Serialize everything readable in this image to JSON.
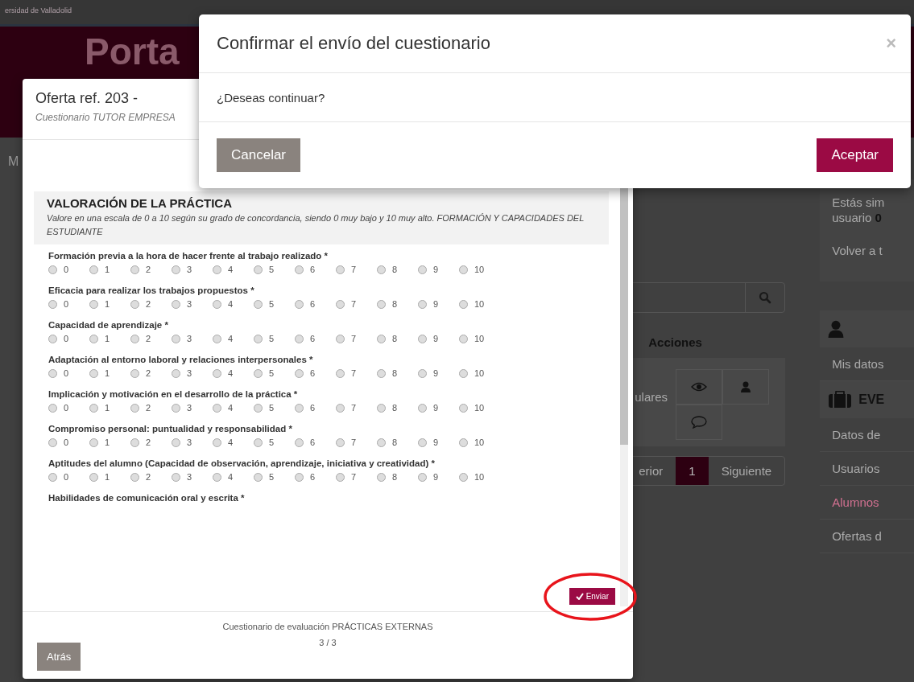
{
  "page": {
    "logo_text": "ersidad de Valladolid",
    "banner_title": "Porta",
    "nav_item": "M",
    "table": {
      "actions_header": "Acciones",
      "row_text": "ulares"
    },
    "pagination": [
      {
        "label": "erior",
        "selected": false
      },
      {
        "label": "1",
        "selected": true
      },
      {
        "label": "Siguiente",
        "selected": false
      }
    ],
    "sidebar": {
      "notice": "Estás sim",
      "notice_user": "usuario **0**",
      "back_link": "Volver a t",
      "profile_link": "Mis datos",
      "section_title": "EVE",
      "items": [
        {
          "label": "Datos de",
          "selected": false
        },
        {
          "label": "Usuarios",
          "selected": false
        },
        {
          "label": "Alumnos",
          "selected": true
        },
        {
          "label": "Ofertas d",
          "selected": false
        }
      ]
    }
  },
  "questionnaire": {
    "title": "Oferta ref. 203 -",
    "subtitle": "Cuestionario TUTOR EMPRESA",
    "section": {
      "title": "VALORACIÓN DE LA PRÁCTICA",
      "description": "Valore en una escala de 0 a 10 según su grado de concordancia, siendo 0 muy bajo y 10 muy alto. FORMACIÓN Y CAPACIDADES DEL ESTUDIANTE"
    },
    "questions": [
      {
        "kind": "scale",
        "label": "Formación previa a la hora de hacer frente al trabajo realizado *",
        "options": [
          {
            "label": "0",
            "selected": false
          },
          {
            "label": "1",
            "selected": false
          },
          {
            "label": "2",
            "selected": false
          },
          {
            "label": "3",
            "selected": false
          },
          {
            "label": "4",
            "selected": false
          },
          {
            "label": "5",
            "selected": false
          },
          {
            "label": "6",
            "selected": false
          },
          {
            "label": "7",
            "selected": false
          },
          {
            "label": "8",
            "selected": false
          },
          {
            "label": "9",
            "selected": false
          },
          {
            "label": "10",
            "selected": false
          }
        ]
      },
      {
        "kind": "scale",
        "label": "Eficacia para realizar los trabajos propuestos *",
        "options": [
          {
            "label": "0",
            "selected": false
          },
          {
            "label": "1",
            "selected": false
          },
          {
            "label": "2",
            "selected": false
          },
          {
            "label": "3",
            "selected": false
          },
          {
            "label": "4",
            "selected": false
          },
          {
            "label": "5",
            "selected": false
          },
          {
            "label": "6",
            "selected": false
          },
          {
            "label": "7",
            "selected": false
          },
          {
            "label": "8",
            "selected": false
          },
          {
            "label": "9",
            "selected": false
          },
          {
            "label": "10",
            "selected": false
          }
        ]
      },
      {
        "kind": "scale",
        "label": "Capacidad de aprendizaje *",
        "options": [
          {
            "label": "0",
            "selected": false
          },
          {
            "label": "1",
            "selected": false
          },
          {
            "label": "2",
            "selected": false
          },
          {
            "label": "3",
            "selected": false
          },
          {
            "label": "4",
            "selected": false
          },
          {
            "label": "5",
            "selected": false
          },
          {
            "label": "6",
            "selected": false
          },
          {
            "label": "7",
            "selected": false
          },
          {
            "label": "8",
            "selected": false
          },
          {
            "label": "9",
            "selected": false
          },
          {
            "label": "10",
            "selected": false
          }
        ]
      },
      {
        "kind": "scale",
        "label": "Adaptación al entorno laboral y relaciones interpersonales *",
        "options": [
          {
            "label": "0",
            "selected": false
          },
          {
            "label": "1",
            "selected": false
          },
          {
            "label": "2",
            "selected": false
          },
          {
            "label": "3",
            "selected": false
          },
          {
            "label": "4",
            "selected": false
          },
          {
            "label": "5",
            "selected": false
          },
          {
            "label": "6",
            "selected": false
          },
          {
            "label": "7",
            "selected": false
          },
          {
            "label": "8",
            "selected": false
          },
          {
            "label": "9",
            "selected": false
          },
          {
            "label": "10",
            "selected": false
          }
        ]
      },
      {
        "kind": "scale",
        "label": "Implicación y motivación en el desarrollo de la práctica *",
        "options": [
          {
            "label": "0",
            "selected": false
          },
          {
            "label": "1",
            "selected": false
          },
          {
            "label": "2",
            "selected": false
          },
          {
            "label": "3",
            "selected": false
          },
          {
            "label": "4",
            "selected": false
          },
          {
            "label": "5",
            "selected": false
          },
          {
            "label": "6",
            "selected": false
          },
          {
            "label": "7",
            "selected": false
          },
          {
            "label": "8",
            "selected": false
          },
          {
            "label": "9",
            "selected": false
          },
          {
            "label": "10",
            "selected": false
          }
        ]
      },
      {
        "kind": "scale",
        "label": "Compromiso personal: puntualidad y responsabilidad *",
        "options": [
          {
            "label": "0",
            "selected": false
          },
          {
            "label": "1",
            "selected": false
          },
          {
            "label": "2",
            "selected": false
          },
          {
            "label": "3",
            "selected": false
          },
          {
            "label": "4",
            "selected": false
          },
          {
            "label": "5",
            "selected": false
          },
          {
            "label": "6",
            "selected": false
          },
          {
            "label": "7",
            "selected": false
          },
          {
            "label": "8",
            "selected": false
          },
          {
            "label": "9",
            "selected": false
          },
          {
            "label": "10",
            "selected": false
          }
        ]
      },
      {
        "kind": "scale",
        "label": "Aptitudes del alumno (Capacidad de observación, aprendizaje, iniciativa y creatividad) *",
        "options": [
          {
            "label": "0",
            "selected": false
          },
          {
            "label": "1",
            "selected": false
          },
          {
            "label": "2",
            "selected": false
          },
          {
            "label": "3",
            "selected": false
          },
          {
            "label": "4",
            "selected": false
          },
          {
            "label": "5",
            "selected": false
          },
          {
            "label": "6",
            "selected": false
          },
          {
            "label": "7",
            "selected": false
          },
          {
            "label": "8",
            "selected": false
          },
          {
            "label": "9",
            "selected": false
          },
          {
            "label": "10",
            "selected": false
          }
        ]
      },
      {
        "kind": "label",
        "label": "Habilidades de comunicación oral y escrita *"
      }
    ],
    "submit": "Enviar",
    "submit_highlighted": true,
    "caption": "Cuestionario de evaluación PRÁCTICAS EXTERNAS",
    "page": "3 / 3",
    "back": "Atrás"
  },
  "confirm": {
    "title": "Confirmar el envío del cuestionario",
    "close": "×",
    "message": "¿Deseas continuar?",
    "buttons": [
      {
        "kind": "cancel",
        "label": "Cancelar"
      },
      {
        "kind": "accept",
        "label": "Aceptar"
      }
    ]
  }
}
